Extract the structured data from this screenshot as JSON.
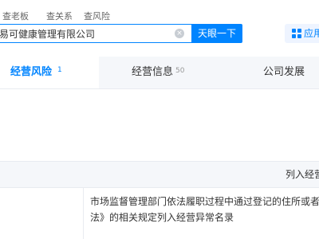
{
  "subnav": {
    "items": [
      "查老板",
      "查关系",
      "查风险"
    ]
  },
  "search": {
    "value": "易可健康管理有限公司",
    "clear_icon": "×",
    "button_label": "天眼一下"
  },
  "app_button": {
    "label": "应用",
    "icon": "grid-icon"
  },
  "tabs": [
    {
      "label": "经营风险",
      "count": "1",
      "active": true
    },
    {
      "label": "经营信息",
      "count": "50",
      "active": false
    },
    {
      "label": "公司发展",
      "count": "",
      "active": false
    }
  ],
  "table": {
    "header": "列入经营",
    "rows": [
      {
        "reason_line1": "市场监督管理部门依法履职过程中通过登记的住所或者",
        "reason_line2": "法》的相关规定列入经营异常名录"
      }
    ]
  },
  "colors": {
    "accent": "#0084ff",
    "tabbar_bg": "#f5f7fa"
  }
}
